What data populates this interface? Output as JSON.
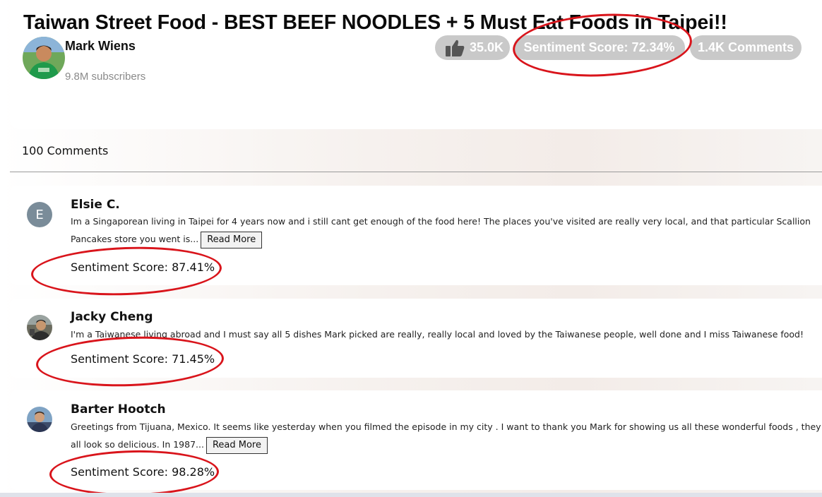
{
  "video": {
    "title": "Taiwan Street Food - BEST BEEF NOODLES + 5 Must Eat Foods in Taipei!!",
    "channel": "Mark Wiens",
    "subscribers": "9.8M subscribers",
    "likes": "35.0K",
    "sentiment": "Sentiment Score: 72.34%",
    "comments": "1.4K Comments"
  },
  "comments_header": "100 Comments",
  "comments": [
    {
      "author": "Elsie C.",
      "avatar_letter": "E",
      "text": "Im a Singaporean living in Taipei for 4 years now and i still cant get enough of the food here! The places you've visited are really very local, and that particular Scallion Pancakes store you went is...",
      "read_more": "Read More",
      "sentiment": "Sentiment Score: 87.41%"
    },
    {
      "author": "Jacky Cheng",
      "text": "I'm a Taiwanese living abroad and I must say all 5 dishes Mark picked are really, really local and loved by the Taiwanese people, well done and I miss Taiwanese food!",
      "sentiment": "Sentiment Score: 71.45%"
    },
    {
      "author": "Barter Hootch",
      "text": "Greetings from Tijuana, Mexico. It seems like yesterday when you filmed the episode in my city . I want to thank you Mark for showing us all these wonderful foods , they all look so delicious. In 1987...",
      "read_more": "Read More",
      "sentiment": "Sentiment Score: 98.28%"
    }
  ],
  "colors": {
    "pill_bg": "#c9c9c9",
    "annotation_red": "#d9141b",
    "avatar_letter_bg": "#7a8c99"
  },
  "icons": [
    "thumbs-up-icon"
  ]
}
